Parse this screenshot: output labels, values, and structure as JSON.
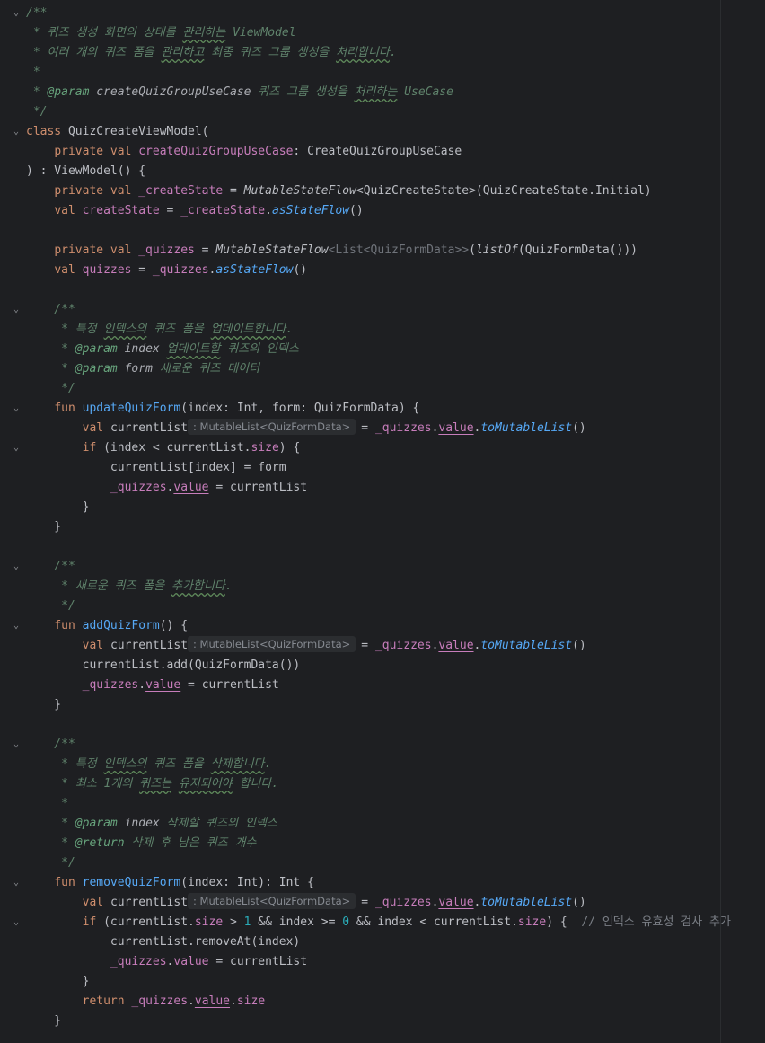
{
  "editor": {
    "lines": [
      {
        "fold": "v",
        "tokens": [
          [
            "doc",
            "/**"
          ]
        ]
      },
      {
        "tokens": [
          [
            "doc",
            " * 퀴즈 생성 화면의 상태를 "
          ],
          [
            "doc-squig",
            "관리하는"
          ],
          [
            "doc",
            " ViewModel"
          ]
        ]
      },
      {
        "tokens": [
          [
            "doc",
            " * 여러 개의 퀴즈 폼을 "
          ],
          [
            "doc-squig",
            "관리하고"
          ],
          [
            "doc",
            " 최종 퀴즈 그룹 생성을 "
          ],
          [
            "doc-squig",
            "처리합니다"
          ],
          [
            "doc",
            "."
          ]
        ]
      },
      {
        "tokens": [
          [
            "doc",
            " *"
          ]
        ]
      },
      {
        "tokens": [
          [
            "doc",
            " * "
          ],
          [
            "doctag",
            "@param"
          ],
          [
            "doc",
            " "
          ],
          [
            "docparam",
            "createQuizGroupUseCase"
          ],
          [
            "doc",
            " 퀴즈 그룹 생성을 "
          ],
          [
            "doc-squig",
            "처리하는"
          ],
          [
            "doc",
            " UseCase"
          ]
        ]
      },
      {
        "tokens": [
          [
            "doc",
            " */"
          ]
        ]
      },
      {
        "fold": "v",
        "tokens": [
          [
            "kw",
            "class "
          ],
          [
            "plain",
            "QuizCreateViewModel("
          ]
        ]
      },
      {
        "tokens": [
          [
            "plain",
            "    "
          ],
          [
            "kw",
            "private val "
          ],
          [
            "prop",
            "createQuizGroupUseCase"
          ],
          [
            "plain",
            ": CreateQuizGroupUseCase"
          ]
        ]
      },
      {
        "tokens": [
          [
            "plain",
            ") : ViewModel() {"
          ]
        ]
      },
      {
        "tokens": [
          [
            "plain",
            "    "
          ],
          [
            "kw",
            "private val "
          ],
          [
            "prop",
            "_createState"
          ],
          [
            "plain",
            " = "
          ],
          [
            "italic",
            "MutableStateFlow"
          ],
          [
            "plain",
            "<QuizCreateState>(QuizCreateState.Initial)"
          ]
        ]
      },
      {
        "tokens": [
          [
            "plain",
            "    "
          ],
          [
            "kw",
            "val "
          ],
          [
            "prop",
            "createState"
          ],
          [
            "plain",
            " = "
          ],
          [
            "prop",
            "_createState"
          ],
          [
            "plain",
            "."
          ],
          [
            "ext",
            "asStateFlow"
          ],
          [
            "plain",
            "()"
          ]
        ]
      },
      {
        "tokens": []
      },
      {
        "tokens": [
          [
            "plain",
            "    "
          ],
          [
            "kw",
            "private val "
          ],
          [
            "prop",
            "_quizzes"
          ],
          [
            "plain",
            " = "
          ],
          [
            "italic",
            "MutableStateFlow"
          ],
          [
            "gen",
            "<List<QuizFormData>>"
          ],
          [
            "plain",
            "("
          ],
          [
            "italic",
            "listOf"
          ],
          [
            "plain",
            "(QuizFormData()))"
          ]
        ]
      },
      {
        "tokens": [
          [
            "plain",
            "    "
          ],
          [
            "kw",
            "val "
          ],
          [
            "prop",
            "quizzes"
          ],
          [
            "plain",
            " = "
          ],
          [
            "prop",
            "_quizzes"
          ],
          [
            "plain",
            "."
          ],
          [
            "ext",
            "asStateFlow"
          ],
          [
            "plain",
            "()"
          ]
        ]
      },
      {
        "tokens": []
      },
      {
        "fold": "v",
        "tokens": [
          [
            "doc",
            "    /**"
          ]
        ]
      },
      {
        "tokens": [
          [
            "doc",
            "     * 특정 "
          ],
          [
            "doc-squig",
            "인덱스의"
          ],
          [
            "doc",
            " 퀴즈 폼을 "
          ],
          [
            "doc-squig",
            "업데이트합니다"
          ],
          [
            "doc",
            "."
          ]
        ]
      },
      {
        "tokens": [
          [
            "doc",
            "     * "
          ],
          [
            "doctag",
            "@param"
          ],
          [
            "doc",
            " "
          ],
          [
            "docparam",
            "index"
          ],
          [
            "doc",
            " "
          ],
          [
            "doc-squig",
            "업데이트할"
          ],
          [
            "doc",
            " 퀴즈의 인덱스"
          ]
        ]
      },
      {
        "tokens": [
          [
            "doc",
            "     * "
          ],
          [
            "doctag",
            "@param"
          ],
          [
            "doc",
            " "
          ],
          [
            "docparam",
            "form"
          ],
          [
            "doc",
            " 새로운 퀴즈 데이터"
          ]
        ]
      },
      {
        "tokens": [
          [
            "doc",
            "     */"
          ]
        ]
      },
      {
        "fold": "v",
        "tokens": [
          [
            "plain",
            "    "
          ],
          [
            "kw",
            "fun "
          ],
          [
            "fn",
            "updateQuizForm"
          ],
          [
            "plain",
            "(index: Int, form: QuizFormData) {"
          ]
        ]
      },
      {
        "tokens": [
          [
            "plain",
            "        "
          ],
          [
            "kw",
            "val "
          ],
          [
            "plain",
            "currentList"
          ],
          [
            "hint",
            ": MutableList<QuizFormData>"
          ],
          [
            "plain",
            "= "
          ],
          [
            "prop",
            "_quizzes"
          ],
          [
            "plain",
            "."
          ],
          [
            "prop-u",
            "value"
          ],
          [
            "plain",
            "."
          ],
          [
            "ext",
            "toMutableList"
          ],
          [
            "plain",
            "()"
          ]
        ]
      },
      {
        "fold": "v",
        "tokens": [
          [
            "plain",
            "        "
          ],
          [
            "kw",
            "if "
          ],
          [
            "plain",
            "(index < currentList."
          ],
          [
            "prop",
            "size"
          ],
          [
            "plain",
            ") {"
          ]
        ]
      },
      {
        "tokens": [
          [
            "plain",
            "            currentList[index] = form"
          ]
        ]
      },
      {
        "tokens": [
          [
            "plain",
            "            "
          ],
          [
            "prop",
            "_quizzes"
          ],
          [
            "plain",
            "."
          ],
          [
            "prop-u",
            "value"
          ],
          [
            "plain",
            " = currentList"
          ]
        ]
      },
      {
        "tokens": [
          [
            "plain",
            "        }"
          ]
        ]
      },
      {
        "tokens": [
          [
            "plain",
            "    }"
          ]
        ]
      },
      {
        "tokens": []
      },
      {
        "fold": "v",
        "tokens": [
          [
            "doc",
            "    /**"
          ]
        ]
      },
      {
        "tokens": [
          [
            "doc",
            "     * 새로운 퀴즈 폼을 "
          ],
          [
            "doc-squig",
            "추가합니다"
          ],
          [
            "doc",
            "."
          ]
        ]
      },
      {
        "tokens": [
          [
            "doc",
            "     */"
          ]
        ]
      },
      {
        "fold": "v",
        "tokens": [
          [
            "plain",
            "    "
          ],
          [
            "kw",
            "fun "
          ],
          [
            "fn",
            "addQuizForm"
          ],
          [
            "plain",
            "() {"
          ]
        ]
      },
      {
        "tokens": [
          [
            "plain",
            "        "
          ],
          [
            "kw",
            "val "
          ],
          [
            "plain",
            "currentList"
          ],
          [
            "hint",
            ": MutableList<QuizFormData>"
          ],
          [
            "plain",
            "= "
          ],
          [
            "prop",
            "_quizzes"
          ],
          [
            "plain",
            "."
          ],
          [
            "prop-u",
            "value"
          ],
          [
            "plain",
            "."
          ],
          [
            "ext",
            "toMutableList"
          ],
          [
            "plain",
            "()"
          ]
        ]
      },
      {
        "tokens": [
          [
            "plain",
            "        currentList.add(QuizFormData())"
          ]
        ]
      },
      {
        "tokens": [
          [
            "plain",
            "        "
          ],
          [
            "prop",
            "_quizzes"
          ],
          [
            "plain",
            "."
          ],
          [
            "prop-u",
            "value"
          ],
          [
            "plain",
            " = currentList"
          ]
        ]
      },
      {
        "tokens": [
          [
            "plain",
            "    }"
          ]
        ]
      },
      {
        "tokens": []
      },
      {
        "fold": "v",
        "tokens": [
          [
            "doc",
            "    /**"
          ]
        ]
      },
      {
        "tokens": [
          [
            "doc",
            "     * 특정 "
          ],
          [
            "doc-squig",
            "인덱스의"
          ],
          [
            "doc",
            " 퀴즈 폼을 "
          ],
          [
            "doc-squig",
            "삭제합니다"
          ],
          [
            "doc",
            "."
          ]
        ]
      },
      {
        "tokens": [
          [
            "doc",
            "     * 최소 1개의 "
          ],
          [
            "doc-squig",
            "퀴즈는"
          ],
          [
            "doc",
            " "
          ],
          [
            "doc-squig",
            "유지되어야"
          ],
          [
            "doc",
            " 합니다."
          ]
        ]
      },
      {
        "tokens": [
          [
            "doc",
            "     *"
          ]
        ]
      },
      {
        "tokens": [
          [
            "doc",
            "     * "
          ],
          [
            "doctag",
            "@param"
          ],
          [
            "doc",
            " "
          ],
          [
            "docparam",
            "index"
          ],
          [
            "doc",
            " 삭제할 퀴즈의 인덱스"
          ]
        ]
      },
      {
        "tokens": [
          [
            "doc",
            "     * "
          ],
          [
            "doctag",
            "@return"
          ],
          [
            "doc",
            " 삭제 후 남은 퀴즈 개수"
          ]
        ]
      },
      {
        "tokens": [
          [
            "doc",
            "     */"
          ]
        ]
      },
      {
        "fold": "v",
        "tokens": [
          [
            "plain",
            "    "
          ],
          [
            "kw",
            "fun "
          ],
          [
            "fn",
            "removeQuizForm"
          ],
          [
            "plain",
            "(index: Int): Int {"
          ]
        ]
      },
      {
        "tokens": [
          [
            "plain",
            "        "
          ],
          [
            "kw",
            "val "
          ],
          [
            "plain",
            "currentList"
          ],
          [
            "hint",
            ": MutableList<QuizFormData>"
          ],
          [
            "plain",
            "= "
          ],
          [
            "prop",
            "_quizzes"
          ],
          [
            "plain",
            "."
          ],
          [
            "prop-u",
            "value"
          ],
          [
            "plain",
            "."
          ],
          [
            "ext",
            "toMutableList"
          ],
          [
            "plain",
            "()"
          ]
        ]
      },
      {
        "fold": "v",
        "tokens": [
          [
            "plain",
            "        "
          ],
          [
            "kw",
            "if "
          ],
          [
            "plain",
            "(currentList."
          ],
          [
            "prop",
            "size"
          ],
          [
            "plain",
            " > "
          ],
          [
            "num",
            "1"
          ],
          [
            "plain",
            " && index >= "
          ],
          [
            "num",
            "0"
          ],
          [
            "plain",
            " && index < currentList."
          ],
          [
            "prop",
            "size"
          ],
          [
            "plain",
            ") {  "
          ],
          [
            "cmt",
            "// 인덱스 유효성 검사 추가"
          ]
        ]
      },
      {
        "tokens": [
          [
            "plain",
            "            currentList.removeAt(index)"
          ]
        ]
      },
      {
        "tokens": [
          [
            "plain",
            "            "
          ],
          [
            "prop",
            "_quizzes"
          ],
          [
            "plain",
            "."
          ],
          [
            "prop-u",
            "value"
          ],
          [
            "plain",
            " = currentList"
          ]
        ]
      },
      {
        "tokens": [
          [
            "plain",
            "        }"
          ]
        ]
      },
      {
        "tokens": [
          [
            "plain",
            "        "
          ],
          [
            "kw",
            "return "
          ],
          [
            "prop",
            "_quizzes"
          ],
          [
            "plain",
            "."
          ],
          [
            "prop-u",
            "value"
          ],
          [
            "plain",
            "."
          ],
          [
            "prop",
            "size"
          ]
        ]
      },
      {
        "tokens": [
          [
            "plain",
            "    }"
          ]
        ]
      }
    ]
  }
}
